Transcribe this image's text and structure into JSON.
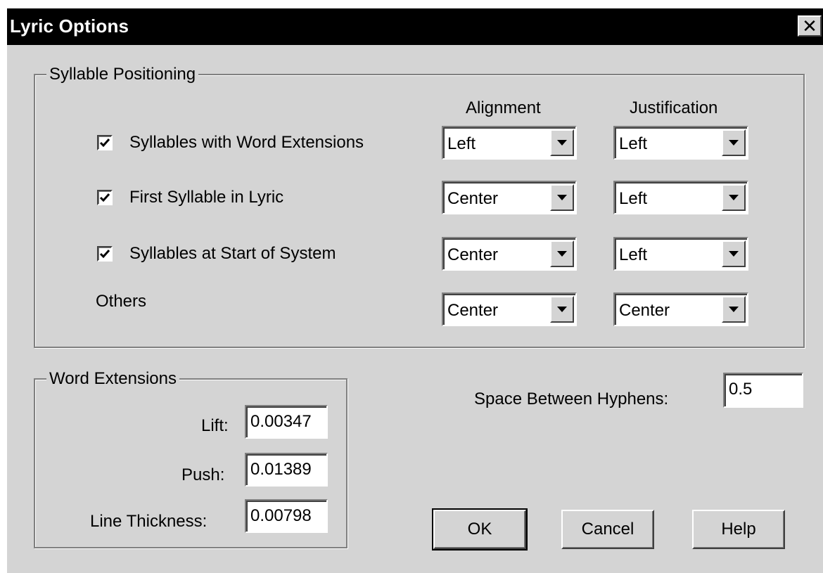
{
  "dialog": {
    "title": "Lyric Options",
    "close_symbol": "✕"
  },
  "syllable_positioning": {
    "legend": "Syllable Positioning",
    "col_alignment": "Alignment",
    "col_justification": "Justification",
    "rows": [
      {
        "label": "Syllables with Word Extensions",
        "checked": true,
        "alignment": "Left",
        "justification": "Left"
      },
      {
        "label": "First Syllable in Lyric",
        "checked": true,
        "alignment": "Center",
        "justification": "Left"
      },
      {
        "label": "Syllables at Start of System",
        "checked": true,
        "alignment": "Center",
        "justification": "Left"
      },
      {
        "label": "Others",
        "checked": null,
        "alignment": "Center",
        "justification": "Center"
      }
    ]
  },
  "word_extensions": {
    "legend": "Word Extensions",
    "lift_label": "Lift:",
    "lift_value": "0.00347",
    "push_label": "Push:",
    "push_value": "0.01389",
    "thickness_label": "Line Thickness:",
    "thickness_value": "0.00798"
  },
  "hyphens": {
    "label": "Space Between Hyphens:",
    "value": "0.5"
  },
  "buttons": {
    "ok": "OK",
    "cancel": "Cancel",
    "help": "Help"
  },
  "icons": {
    "checkmark": "check-icon",
    "dropdown": "chevron-down-icon",
    "close": "close-icon"
  }
}
